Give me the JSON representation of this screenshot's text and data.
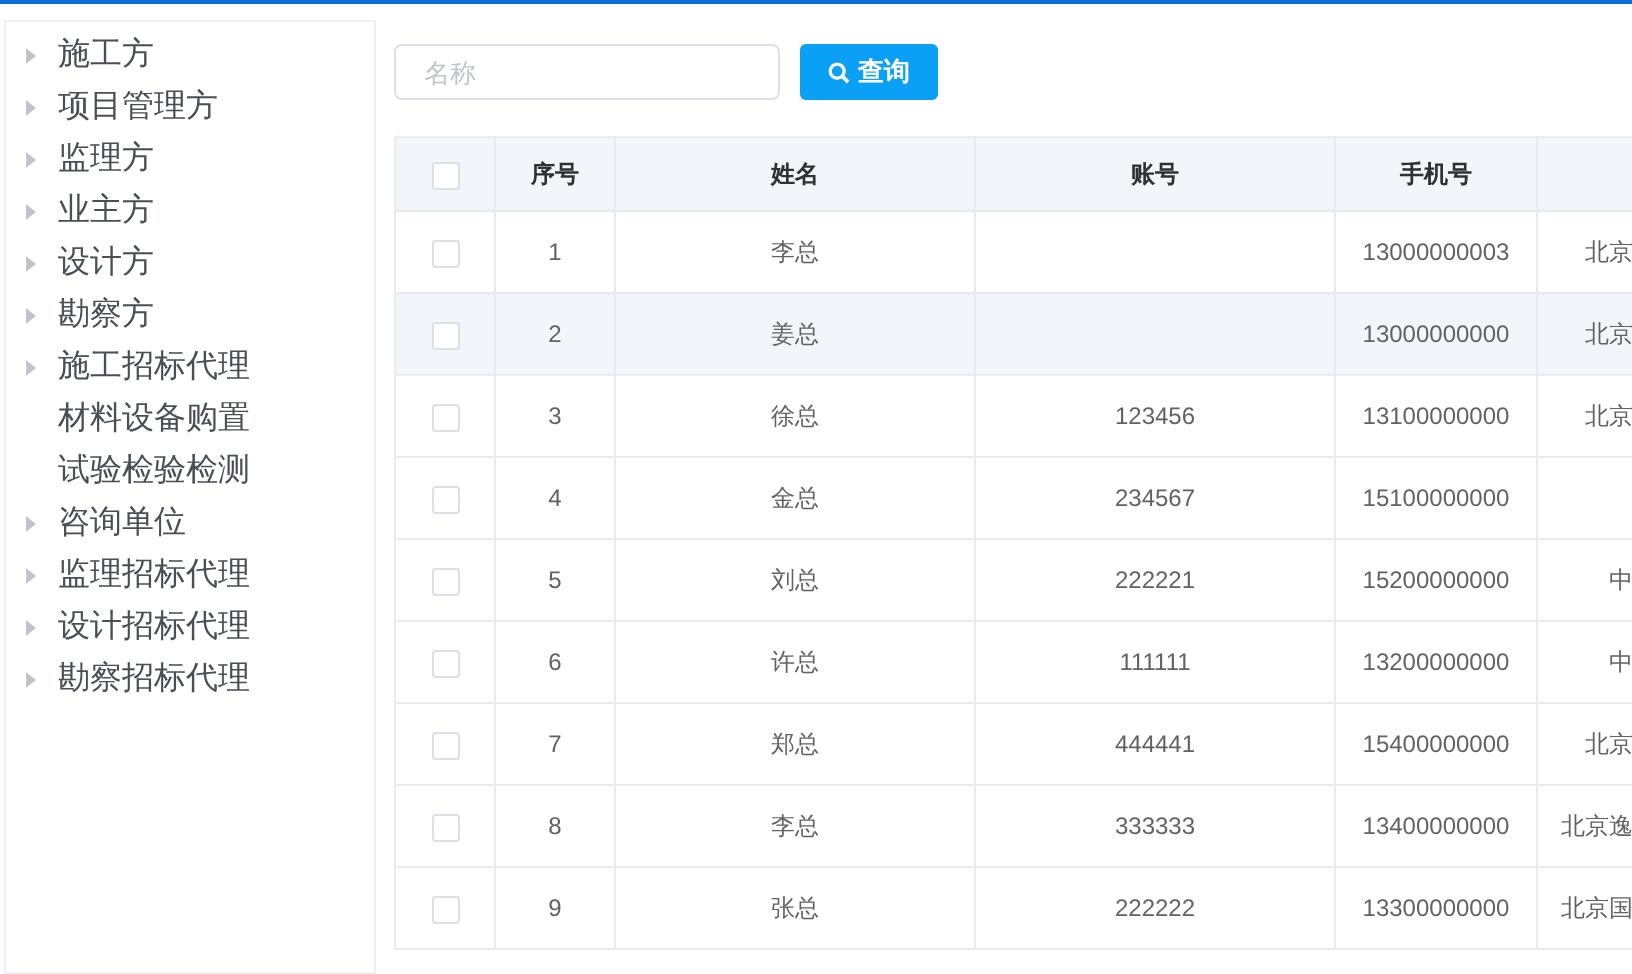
{
  "sidebar": {
    "items": [
      {
        "label": "施工方",
        "kind": "branch"
      },
      {
        "label": "项目管理方",
        "kind": "branch"
      },
      {
        "label": "监理方",
        "kind": "branch"
      },
      {
        "label": "业主方",
        "kind": "branch"
      },
      {
        "label": "设计方",
        "kind": "branch"
      },
      {
        "label": "勘察方",
        "kind": "branch"
      },
      {
        "label": "施工招标代理",
        "kind": "branch"
      },
      {
        "label": "材料设备购置",
        "kind": "leaf"
      },
      {
        "label": "试验检验检测",
        "kind": "leaf"
      },
      {
        "label": "咨询单位",
        "kind": "branch"
      },
      {
        "label": "监理招标代理",
        "kind": "branch"
      },
      {
        "label": "设计招标代理",
        "kind": "branch"
      },
      {
        "label": "勘察招标代理",
        "kind": "branch"
      }
    ]
  },
  "search": {
    "placeholder": "名称",
    "button": "查询"
  },
  "table": {
    "select_all_checked": false,
    "columns": [
      "序号",
      "姓名",
      "账号",
      "手机号"
    ],
    "rows": [
      {
        "checked": false,
        "highlighted": false,
        "cells": [
          "1",
          "李总",
          "",
          "13000000003",
          "北京"
        ]
      },
      {
        "checked": false,
        "highlighted": true,
        "cells": [
          "2",
          "姜总",
          "",
          "13000000000",
          "北京"
        ]
      },
      {
        "checked": false,
        "highlighted": false,
        "cells": [
          "3",
          "徐总",
          "123456",
          "13100000000",
          "北京"
        ]
      },
      {
        "checked": false,
        "highlighted": false,
        "cells": [
          "4",
          "金总",
          "234567",
          "15100000000",
          ""
        ]
      },
      {
        "checked": false,
        "highlighted": false,
        "cells": [
          "5",
          "刘总",
          "222221",
          "15200000000",
          "中"
        ]
      },
      {
        "checked": false,
        "highlighted": false,
        "cells": [
          "6",
          "许总",
          "111111",
          "13200000000",
          "中"
        ]
      },
      {
        "checked": false,
        "highlighted": false,
        "cells": [
          "7",
          "郑总",
          "444441",
          "15400000000",
          "北京"
        ]
      },
      {
        "checked": false,
        "highlighted": false,
        "cells": [
          "8",
          "李总",
          "333333",
          "13400000000",
          "北京逸"
        ]
      },
      {
        "checked": false,
        "highlighted": false,
        "cells": [
          "9",
          "张总",
          "222222",
          "13300000000",
          "北京国"
        ]
      }
    ]
  }
}
